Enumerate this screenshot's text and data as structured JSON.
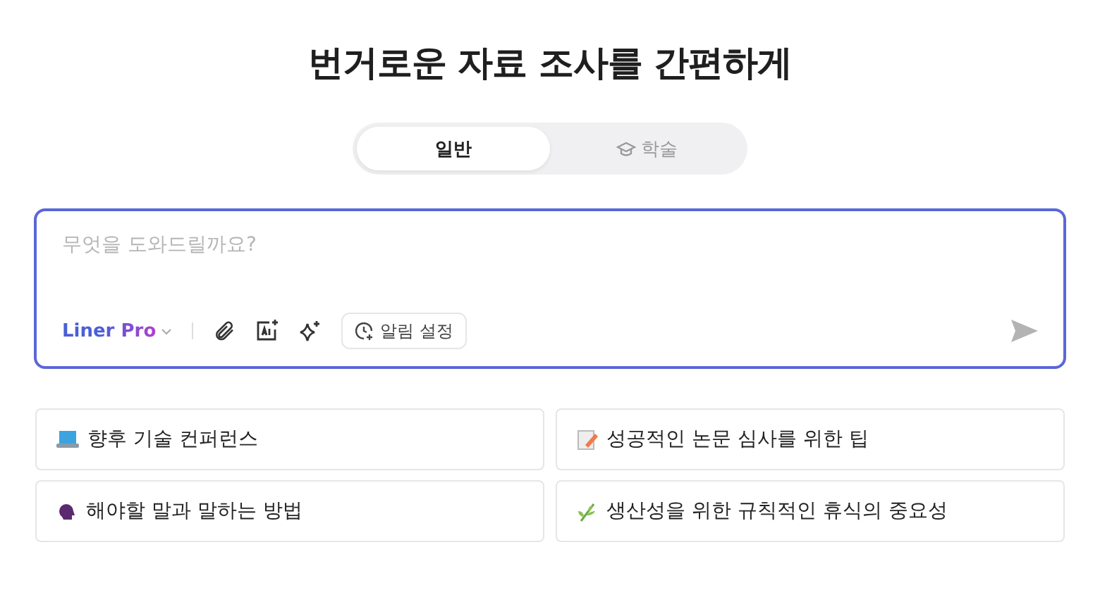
{
  "title": "번거로운 자료 조사를 간편하게",
  "tabs": [
    {
      "label": "일반",
      "selected": true,
      "kind": "plain"
    },
    {
      "label": "학술",
      "selected": false,
      "kind": "academic"
    }
  ],
  "composer": {
    "placeholder": "무엇을 도와드릴까요?",
    "model": "Liner Pro",
    "alarm_button": "알림 설정"
  },
  "suggestions": [
    {
      "label": "향후 기술 컨퍼런스",
      "kind": "laptop"
    },
    {
      "label": "성공적인 논문 심사를 위한 팁",
      "kind": "memo"
    },
    {
      "label": "해야할 말과 말하는 방법",
      "kind": "speaking"
    },
    {
      "label": "생산성을 위한 규칙적인 휴식의 중요성",
      "kind": "herb"
    }
  ]
}
